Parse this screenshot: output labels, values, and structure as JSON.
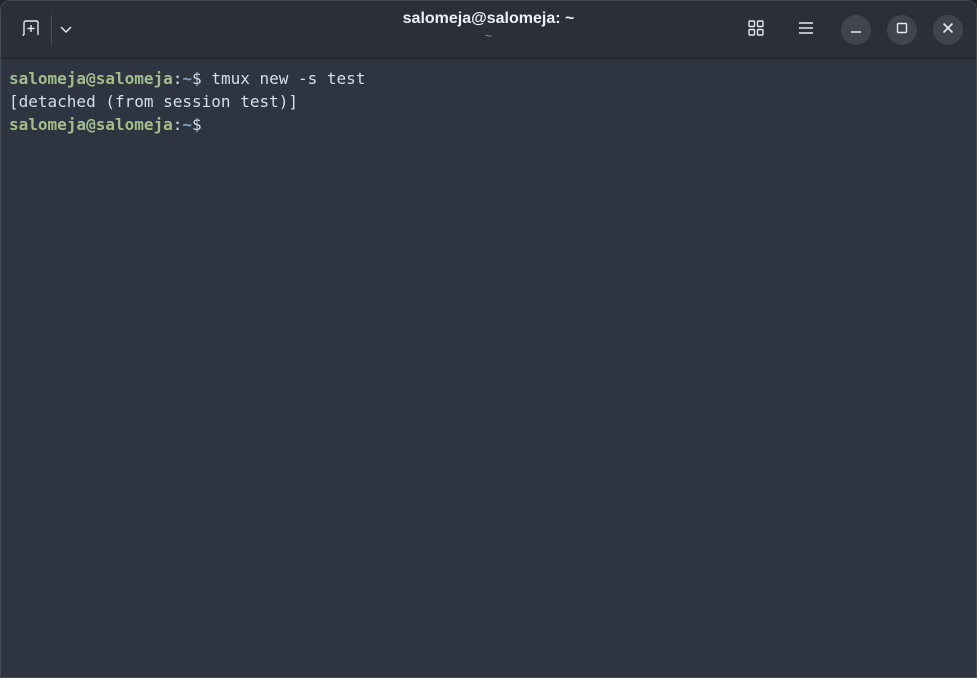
{
  "window": {
    "title": "salomeja@salomeja: ~",
    "subtitle": "~"
  },
  "titlebar": {
    "icons": {
      "new_tab": "new-tab-icon",
      "dropdown": "chevron-down-icon",
      "grid": "grid-view-icon",
      "menu": "hamburger-menu-icon",
      "minimize": "minimize-icon",
      "maximize": "maximize-icon",
      "close": "close-icon"
    }
  },
  "terminal": {
    "colors": {
      "background": "#2e3440",
      "user_host": "#a3be8c",
      "path": "#81a1c1",
      "text": "#d8dee9"
    },
    "lines": [
      {
        "user_host": "salomeja@salomeja",
        "colon": ":",
        "path": "~",
        "dollar": "$",
        "command": " tmux new -s test"
      },
      {
        "output": "[detached (from session test)]"
      },
      {
        "user_host": "salomeja@salomeja",
        "colon": ":",
        "path": "~",
        "dollar": "$",
        "command": ""
      }
    ]
  }
}
